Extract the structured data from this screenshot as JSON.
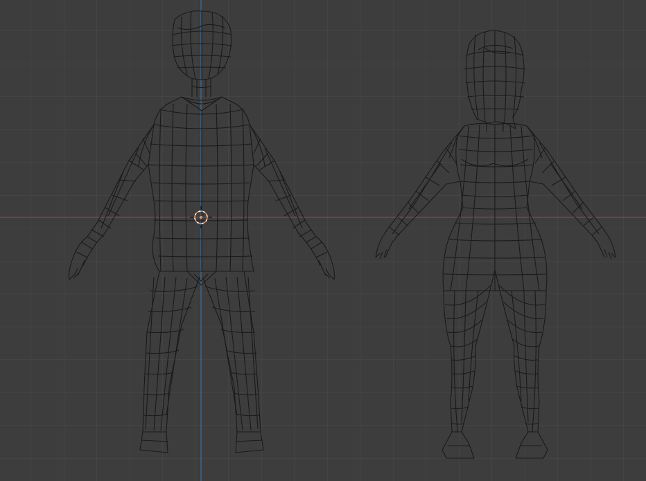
{
  "viewport": {
    "type": "3d-viewport",
    "view": "front-orthographic",
    "shading": "wireframe",
    "grid": true,
    "colors": {
      "background": "#3d3d3d",
      "grid_line": "#4a4a4a",
      "x_axis": "#9e3d4a",
      "z_axis": "#3a6e9c",
      "wireframe": "#1a1a1a",
      "cursor": "#e8925a"
    }
  },
  "objects": [
    {
      "name": "male-character-mesh",
      "icon": "mesh-icon"
    },
    {
      "name": "female-character-mesh",
      "icon": "mesh-icon"
    }
  ],
  "cursor_3d": {
    "icon": "3d-cursor-icon"
  }
}
